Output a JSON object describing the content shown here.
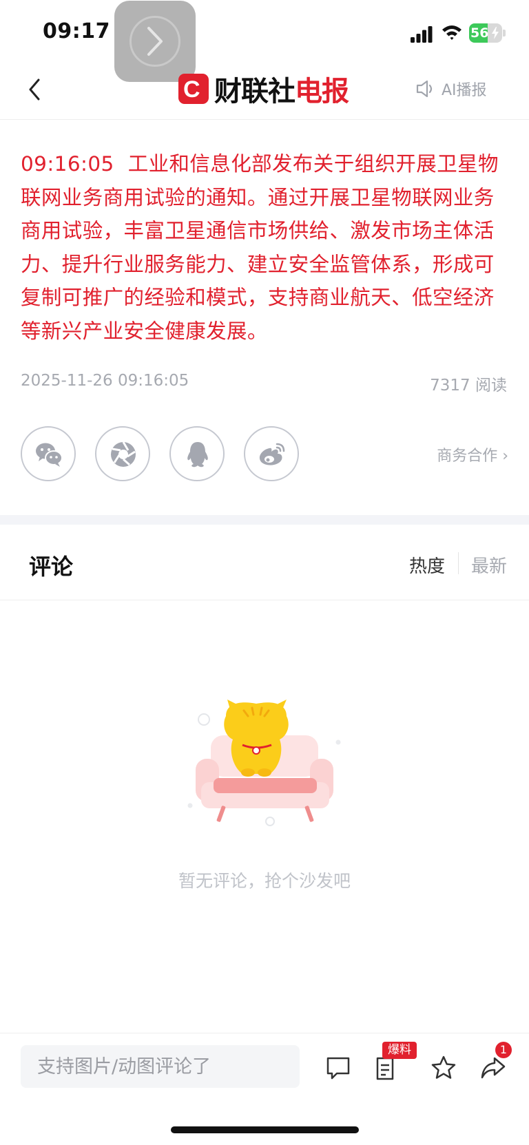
{
  "status_bar": {
    "time": "09:17",
    "battery_level": "56",
    "battery_fill_percent": 56,
    "icons": [
      "signal-icon",
      "wifi-icon",
      "battery-charging-icon"
    ]
  },
  "nav": {
    "brand_letter": "C",
    "brand_name": "财联社",
    "brand_sub": "电报",
    "ai_broadcast": "AI播报",
    "icons": [
      "back-icon",
      "speaker-icon"
    ]
  },
  "article": {
    "time": "09:16:05",
    "body": "工业和信息化部发布关于组织开展卫星物联网业务商用试验的通知。通过开展卫星物联网业务商用试验，丰富卫星通信市场供给、激发市场主体活力、提升行业服务能力、建立安全监管体系，形成可复制可推广的经验和模式，支持商业航天、低空经济等新兴产业安全健康发展。",
    "date": "2025-11-26 09:16:05",
    "reads": "7317 阅读",
    "accent_color": "#e1212e"
  },
  "share": {
    "icons": [
      "wechat-icon",
      "moments-icon",
      "qq-icon",
      "weibo-icon"
    ],
    "business": "商务合作 ›"
  },
  "comments": {
    "title": "评论",
    "sort_hot": "热度",
    "sort_new": "最新",
    "empty_text": "暂无评论，抢个沙发吧"
  },
  "bottom_bar": {
    "input_placeholder": "支持图片/动图评论了",
    "tip_badge": "爆料",
    "share_count": "1",
    "icons": [
      "comment-icon",
      "tip-off-icon",
      "star-icon",
      "share-icon"
    ]
  }
}
